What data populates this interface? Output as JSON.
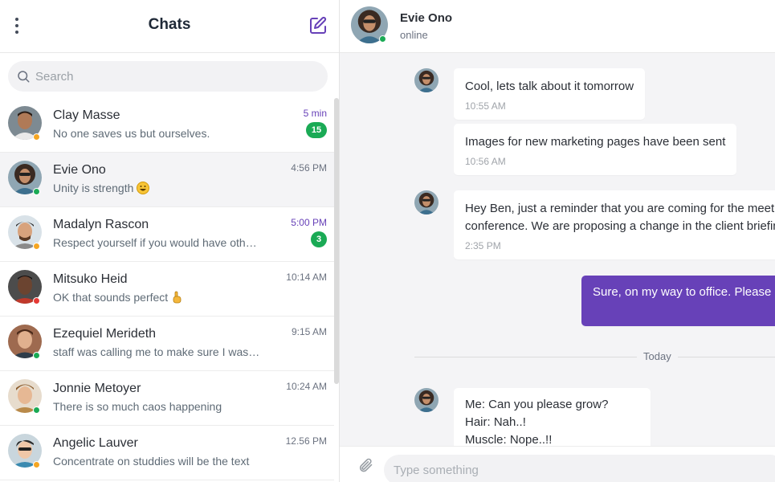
{
  "sidebar": {
    "title": "Chats",
    "menu_icon": "kebab-menu-icon",
    "compose_icon": "compose-icon",
    "search": {
      "placeholder": "Search"
    },
    "chats": [
      {
        "name": "Clay Masse",
        "preview": "No one saves us but ourselves.",
        "time": "5 min",
        "unread": "15",
        "status": "away"
      },
      {
        "name": "Evie Ono",
        "preview": "Unity is strength",
        "time": "4:56 PM",
        "unread": "",
        "status": "online",
        "emoji": "grinning-face"
      },
      {
        "name": "Madalyn Rascon",
        "preview": "Respect yourself if you would have others...",
        "time": "5:00 PM",
        "unread": "3",
        "status": "away"
      },
      {
        "name": "Mitsuko Heid",
        "preview": "OK that sounds perfect",
        "time": "10:14 AM",
        "unread": "",
        "status": "busy",
        "emoji": "pointing-hand"
      },
      {
        "name": "Ezequiel Merideth",
        "preview": "staff was calling me to make sure I was t...",
        "time": "9:15 AM",
        "unread": "",
        "status": "online"
      },
      {
        "name": "Jonnie Metoyer",
        "preview": "There is so much caos happening",
        "time": "10:24 AM",
        "unread": "",
        "status": "online"
      },
      {
        "name": "Angelic Lauver",
        "preview": "Concentrate on studdies will be the text",
        "time": "12.56 PM",
        "unread": "",
        "status": "away"
      }
    ]
  },
  "conversation": {
    "contact_name": "Evie Ono",
    "contact_status": "online",
    "messages": [
      {
        "text": "Cool, lets talk about it tomorrow",
        "time": "10:55 AM",
        "direction": "in"
      },
      {
        "text": "Images for new marketing pages have been sent",
        "time": "10:56 AM",
        "direction": "in"
      },
      {
        "text_line1": "Hey Ben, just a reminder that you are coming for the meeting",
        "text_line2": "conference. We are proposing a change in the client briefing",
        "time": "2:35 PM",
        "direction": "in"
      },
      {
        "text": "Sure, on my way to office. Please give me a few minutes",
        "direction": "out"
      },
      {
        "text_line1": "Me: Can you please grow?",
        "text_line2": "Hair: Nah..!",
        "text_line3": "Muscle: Nope..!!",
        "direction": "in"
      }
    ],
    "divider_label": "Today",
    "composer": {
      "placeholder": "Type something",
      "attach_icon": "paperclip-icon"
    }
  },
  "colors": {
    "accent": "#6741b8",
    "badge": "#1aaa55",
    "online": "#1aaa55",
    "away": "#f5a623",
    "busy": "#e53935"
  }
}
